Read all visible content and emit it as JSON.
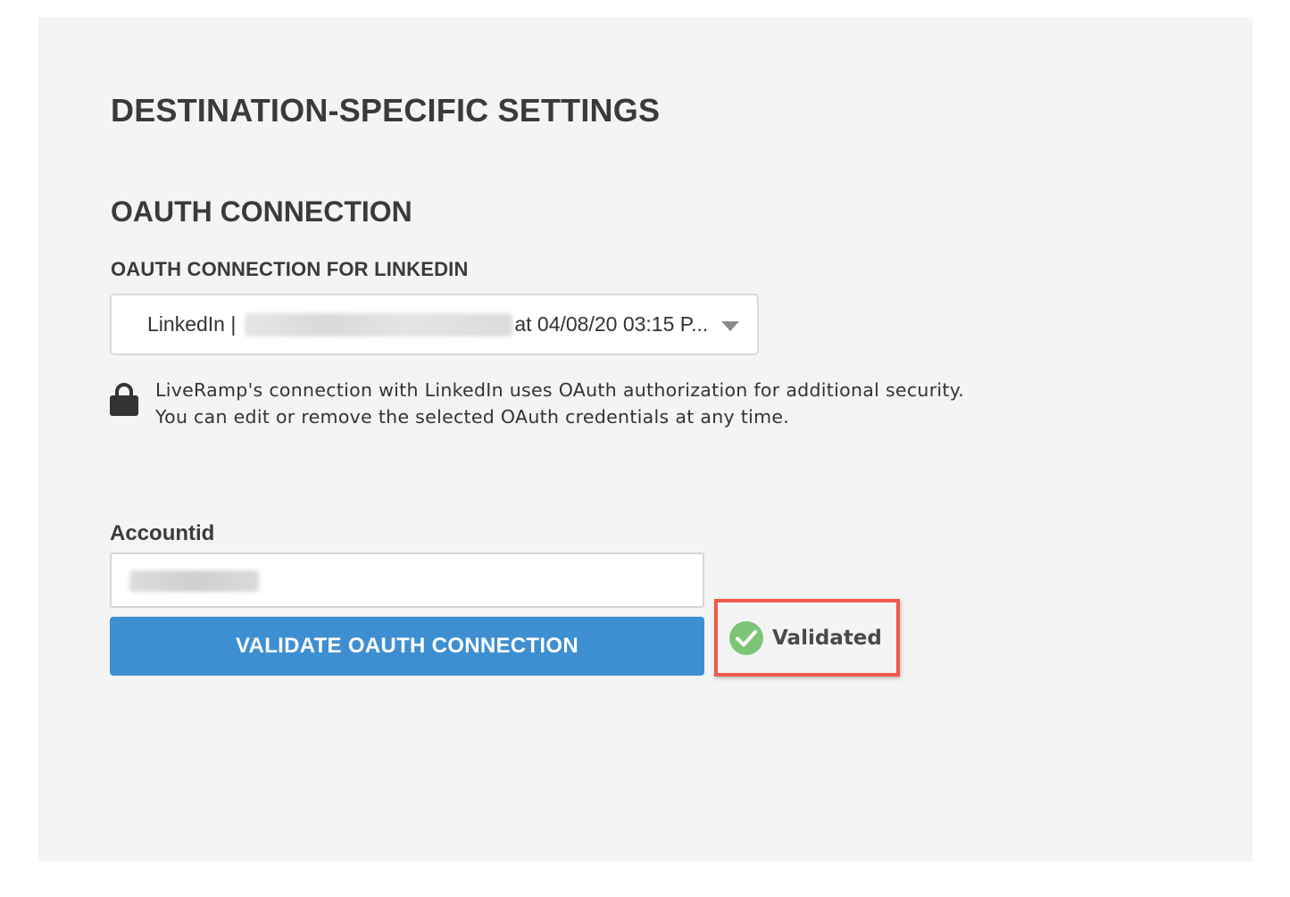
{
  "settings": {
    "title": "DESTINATION-SPECIFIC SETTINGS"
  },
  "oauth": {
    "section_title": "OAUTH CONNECTION",
    "field_label": "OAUTH CONNECTION FOR LINKEDIN",
    "selected_prefix": "LinkedIn |",
    "selected_suffix": "at 04/08/20 03:15 P...",
    "info_line1": "LiveRamp's connection with LinkedIn uses OAuth authorization for additional security.",
    "info_line2": "You can edit or remove the selected OAuth credentials at any time."
  },
  "account": {
    "label": "Accountid"
  },
  "actions": {
    "validate_label": "VALIDATE OAUTH CONNECTION"
  },
  "status": {
    "text": "Validated",
    "color": "#7cc576",
    "highlight_color": "#ee5a4a"
  },
  "icons": {
    "lock": "lock-icon",
    "check": "check-circle-icon",
    "dropdown": "caret-down-icon"
  }
}
